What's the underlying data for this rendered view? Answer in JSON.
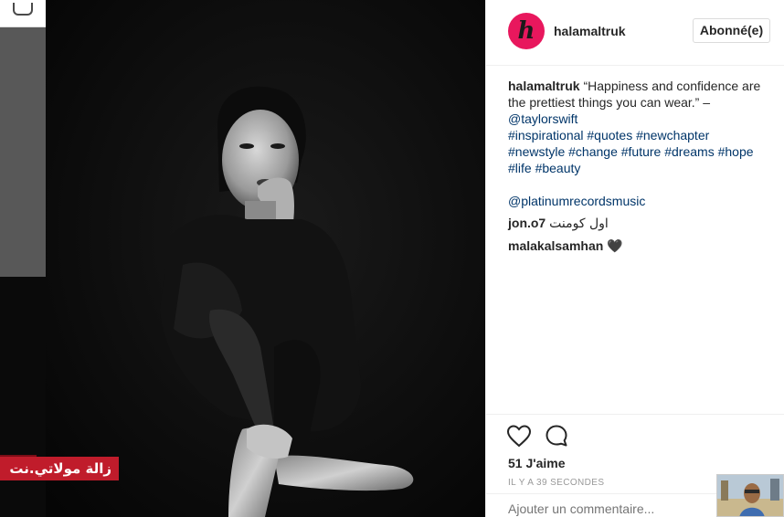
{
  "post": {
    "username": "halamaltruk",
    "avatar_letter": "h",
    "follow_label": "Abonné(e)",
    "caption": {
      "line1": "“Happiness and confidence are",
      "line2": "the prettiest things you can wear.” –",
      "mention": "@taylorswift",
      "hashtags_line1": "#inspirational #quotes #newchapter",
      "hashtags_line2": "#newstyle #change #future #dreams #hope",
      "hashtags_line3": "#life #beauty",
      "mention2": "@platinumrecordsmusic"
    },
    "comments": [
      {
        "user": "jon.o7",
        "text": "اول كومنت"
      },
      {
        "user": "malakalsamhan",
        "text": "🖤"
      }
    ],
    "likes_label": "51 J'aime",
    "timestamp": "IL Y A 39 SECONDES",
    "add_comment_placeholder": "Ajouter un commentaire..."
  },
  "watermark": {
    "text": "زالة مولاتي.نت"
  },
  "icons": {
    "like": "heart-icon",
    "comment": "comment-bubble-icon",
    "corner": "camera-icon"
  },
  "colors": {
    "accent_link": "#003569",
    "avatar_bg": "#e8175d",
    "watermark_bg": "#c01c2b"
  }
}
